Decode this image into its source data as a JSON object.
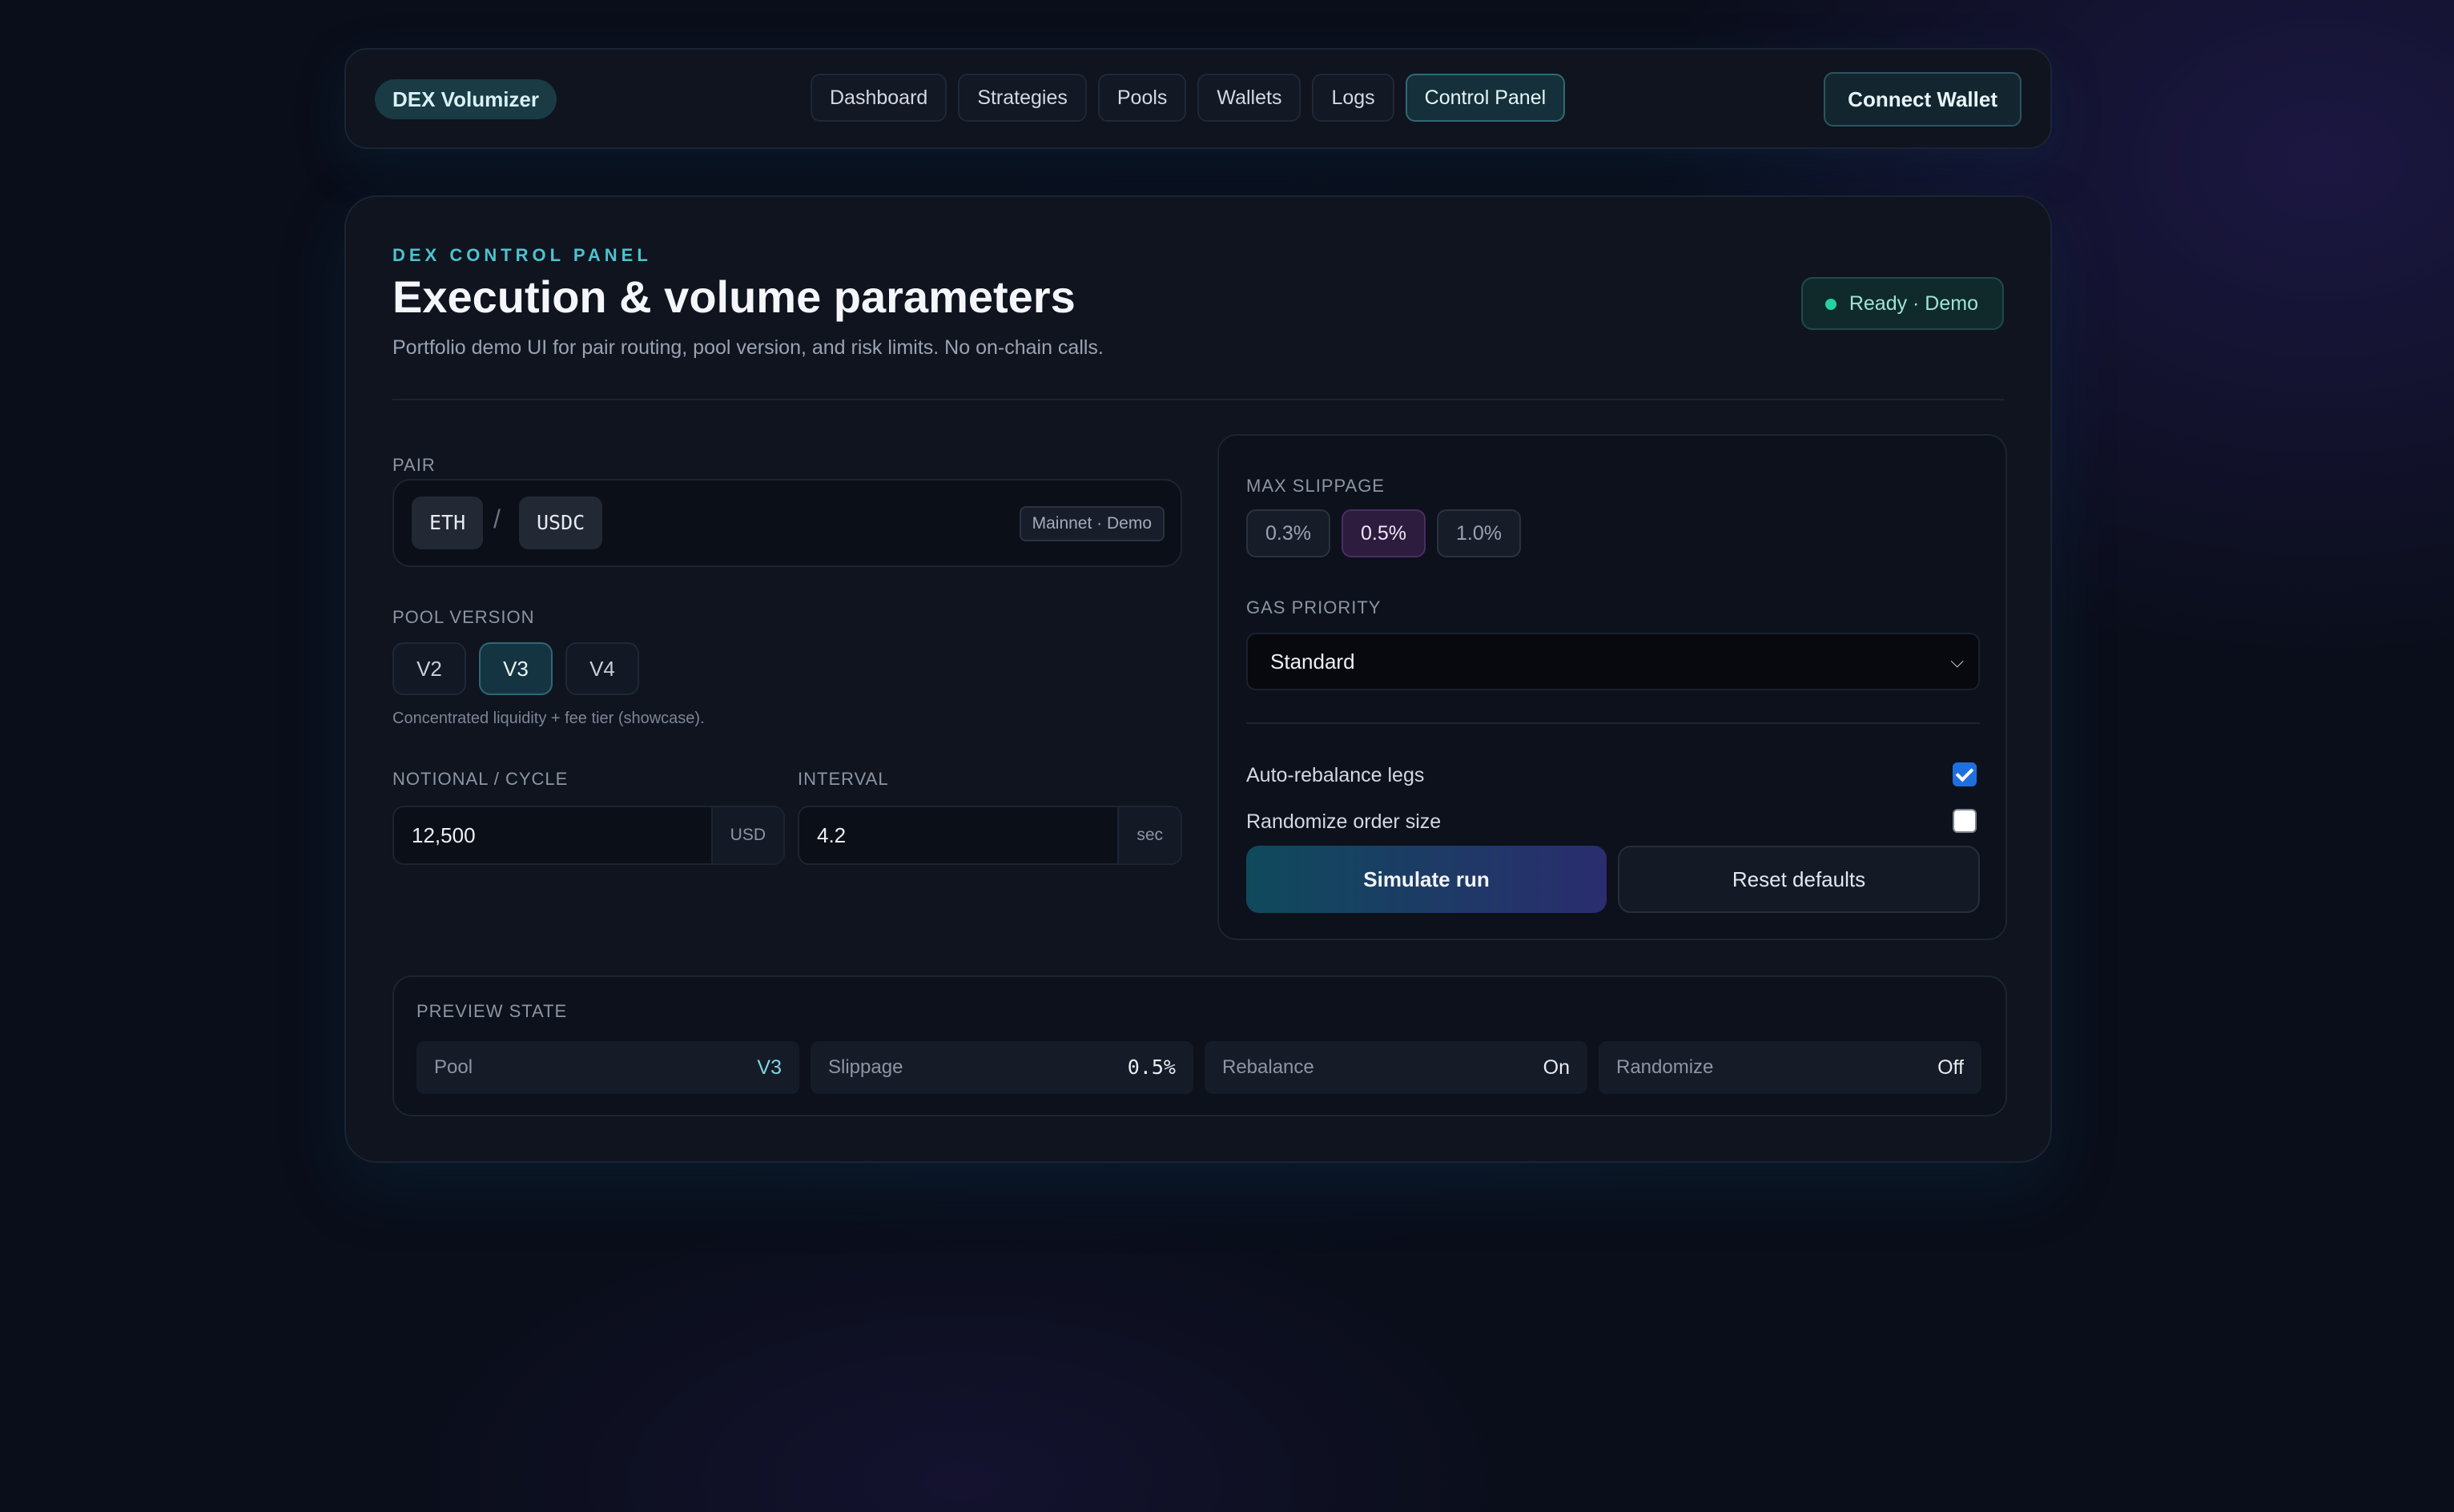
{
  "brand": "DEX Volumizer",
  "nav": [
    "Dashboard",
    "Strategies",
    "Pools",
    "Wallets",
    "Logs",
    "Control Panel"
  ],
  "nav_active": "Control Panel",
  "connect_label": "Connect Wallet",
  "header": {
    "kicker": "DEX CONTROL PANEL",
    "title": "Execution & volume parameters",
    "subtitle": "Portfolio demo UI for pair routing, pool version, and risk limits. No on-chain calls.",
    "status": "Ready · Demo"
  },
  "pair": {
    "label": "PAIR",
    "base": "ETH",
    "separator": "/",
    "quote": "USDC",
    "network": "Mainnet · Demo"
  },
  "pool_version": {
    "label": "POOL VERSION",
    "options": [
      "V2",
      "V3",
      "V4"
    ],
    "selected": "V3",
    "hint": "Concentrated liquidity + fee tier (showcase)."
  },
  "notional": {
    "label": "NOTIONAL / CYCLE",
    "value": "12,500",
    "unit": "USD"
  },
  "interval": {
    "label": "INTERVAL",
    "value": "4.2",
    "unit": "sec"
  },
  "slippage": {
    "label": "MAX SLIPPAGE",
    "options": [
      "0.3%",
      "0.5%",
      "1.0%"
    ],
    "selected": "0.5%"
  },
  "gas": {
    "label": "GAS PRIORITY",
    "value": "Standard"
  },
  "toggles": [
    {
      "label": "Auto-rebalance legs",
      "checked": true
    },
    {
      "label": "Randomize order size",
      "checked": false
    }
  ],
  "actions": {
    "primary": "Simulate run",
    "secondary": "Reset defaults"
  },
  "preview": {
    "label": "PREVIEW STATE",
    "items": [
      {
        "key": "Pool",
        "value": "V3"
      },
      {
        "key": "Slippage",
        "value": "0.5%"
      },
      {
        "key": "Rebalance",
        "value": "On"
      },
      {
        "key": "Randomize",
        "value": "Off"
      }
    ]
  },
  "colors": {
    "accent": "#4cc3cf",
    "status_dot": "#22d3a0",
    "checkbox_on": "#1f6fe0",
    "slippage_active": "#2e1c3e"
  },
  "icons": {
    "status": "status-dot-icon",
    "select": "chevron-down-icon",
    "check": "checkmark-icon"
  }
}
